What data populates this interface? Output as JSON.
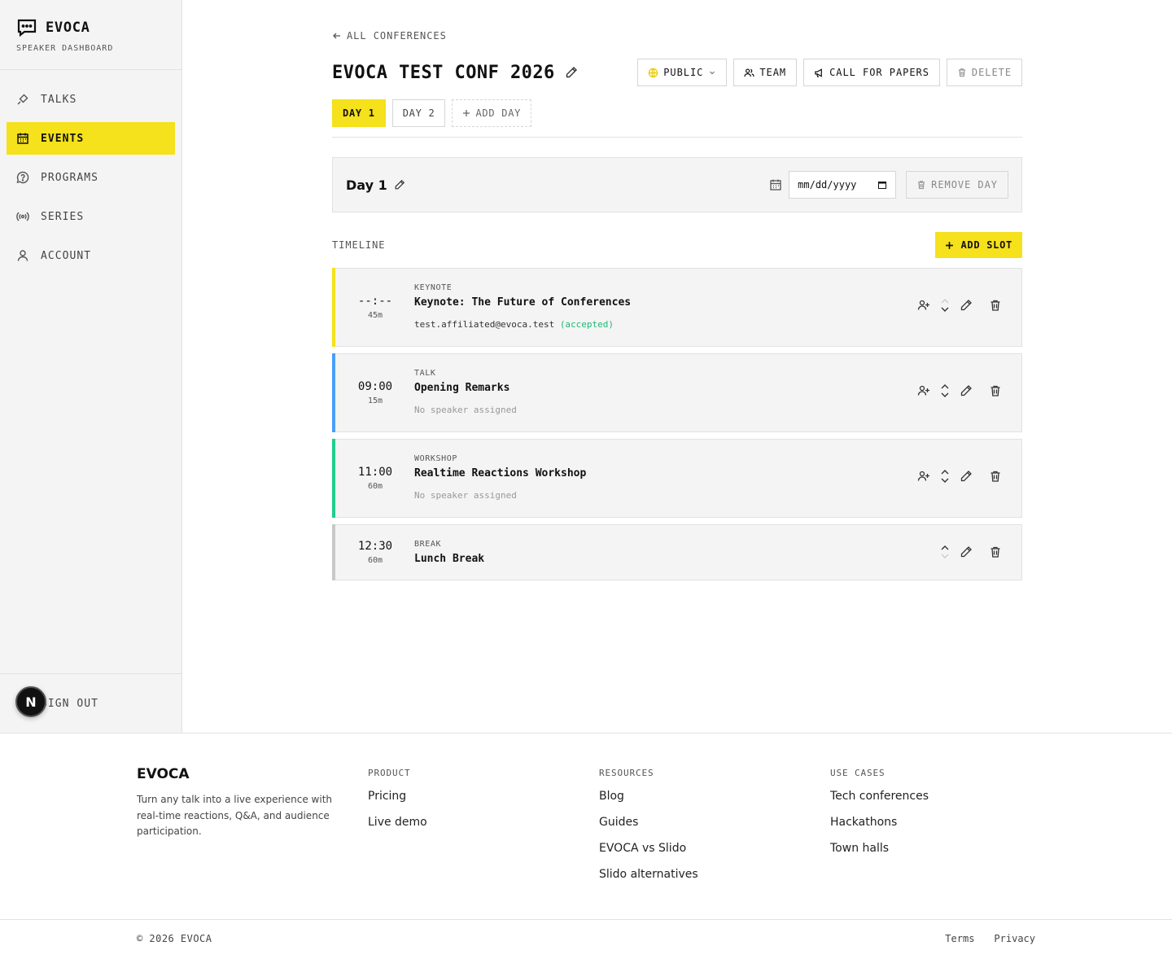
{
  "sidebar": {
    "brand": "EVOCA",
    "subtitle": "SPEAKER DASHBOARD",
    "nav": [
      {
        "label": "TALKS",
        "icon": "mic-icon"
      },
      {
        "label": "EVENTS",
        "icon": "calendar-icon",
        "active": true
      },
      {
        "label": "PROGRAMS",
        "icon": "help-circle-icon"
      },
      {
        "label": "SERIES",
        "icon": "broadcast-icon"
      },
      {
        "label": "ACCOUNT",
        "icon": "user-icon"
      }
    ],
    "sign_out": "SIGN OUT",
    "badge": "N"
  },
  "header": {
    "back": "ALL CONFERENCES",
    "title": "EVOCA TEST CONF 2026",
    "actions": {
      "visibility": "PUBLIC",
      "team": "TEAM",
      "cfp": "CALL FOR PAPERS",
      "delete": "DELETE"
    }
  },
  "tabs": {
    "days": [
      "DAY 1",
      "DAY 2"
    ],
    "add": "ADD DAY"
  },
  "day": {
    "name": "Day 1",
    "date_placeholder": "mm/dd/yyyy",
    "remove": "REMOVE DAY"
  },
  "timeline": {
    "label": "TIMELINE",
    "add_slot": "ADD SLOT",
    "slots": [
      {
        "time": "--:--",
        "duration": "45m",
        "type": "KEYNOTE",
        "title": "Keynote: The Future of Conferences",
        "speaker": "test.affiliated@evoca.test",
        "status": "(accepted)",
        "accent": "#f5e11c"
      },
      {
        "time": "09:00",
        "duration": "15m",
        "type": "TALK",
        "title": "Opening Remarks",
        "speaker": "No speaker assigned",
        "accent": "#4a9ff5"
      },
      {
        "time": "11:00",
        "duration": "60m",
        "type": "WORKSHOP",
        "title": "Realtime Reactions Workshop",
        "speaker": "No speaker assigned",
        "accent": "#1fcf8c"
      },
      {
        "time": "12:30",
        "duration": "60m",
        "type": "BREAK",
        "title": "Lunch Break",
        "accent": "#c8c8c8"
      }
    ]
  },
  "footer": {
    "brand": "EVOCA",
    "tagline": "Turn any talk into a live experience with real-time reactions, Q&A, and audience participation.",
    "columns": [
      {
        "heading": "PRODUCT",
        "links": [
          "Pricing",
          "Live demo"
        ]
      },
      {
        "heading": "RESOURCES",
        "links": [
          "Blog",
          "Guides",
          "EVOCA vs Slido",
          "Slido alternatives"
        ]
      },
      {
        "heading": "USE CASES",
        "links": [
          "Tech conferences",
          "Hackathons",
          "Town halls"
        ]
      }
    ],
    "copyright": "© 2026 EVOCA",
    "legal": [
      "Terms",
      "Privacy"
    ]
  }
}
